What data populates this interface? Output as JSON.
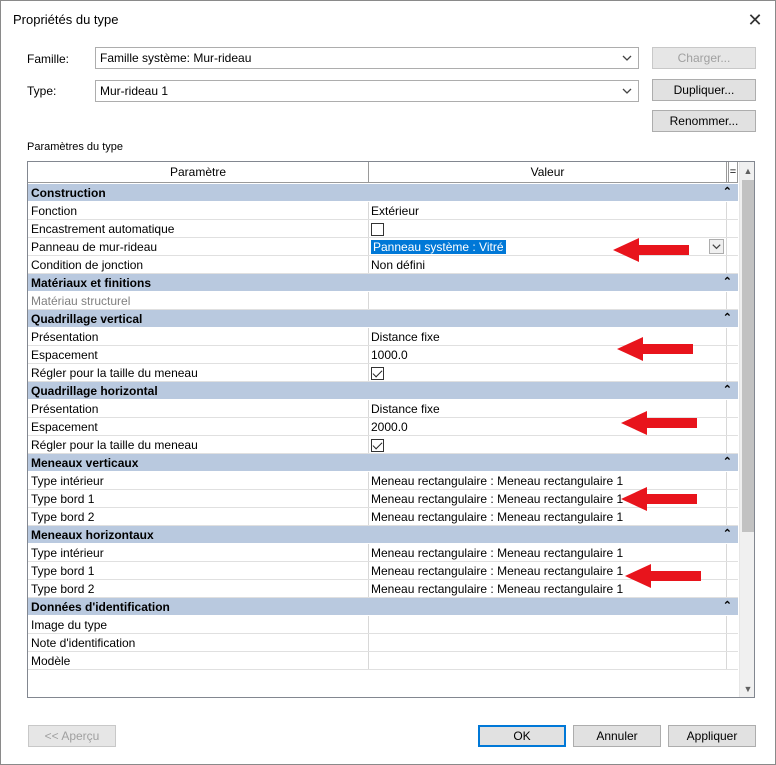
{
  "dialog": {
    "title": "Propriétés du type",
    "close_glyph": "✕"
  },
  "famille": {
    "label": "Famille:",
    "value": "Famille système: Mur-rideau",
    "load_label": "Charger..."
  },
  "type": {
    "label": "Type:",
    "value": "Mur-rideau 1",
    "duplicate_label": "Dupliquer...",
    "rename_label": "Renommer..."
  },
  "params": {
    "section_label": "Paramètres du type",
    "col_param": "Paramètre",
    "col_value": "Valeur",
    "col_eq": "=",
    "collapse_glyph": "⌃",
    "sections": [
      {
        "title": "Construction",
        "rows": [
          {
            "name": "Fonction",
            "value": "Extérieur"
          },
          {
            "name": "Encastrement automatique",
            "value": "",
            "checkbox": false
          },
          {
            "name": "Panneau de mur-rideau",
            "value": "Panneau système : Vitré",
            "selected": true
          },
          {
            "name": "Condition de jonction",
            "value": "Non défini"
          }
        ]
      },
      {
        "title": "Matériaux et finitions",
        "rows": [
          {
            "name": "Matériau structurel",
            "value": "",
            "disabled": true
          }
        ]
      },
      {
        "title": "Quadrillage vertical",
        "rows": [
          {
            "name": "Présentation",
            "value": "Distance fixe"
          },
          {
            "name": "Espacement",
            "value": "1000.0"
          },
          {
            "name": "Régler pour la taille du meneau",
            "value": "",
            "checkbox": true
          }
        ]
      },
      {
        "title": "Quadrillage horizontal",
        "rows": [
          {
            "name": "Présentation",
            "value": "Distance fixe"
          },
          {
            "name": "Espacement",
            "value": "2000.0"
          },
          {
            "name": "Régler pour la taille du meneau",
            "value": "",
            "checkbox": true
          }
        ]
      },
      {
        "title": "Meneaux verticaux",
        "rows": [
          {
            "name": "Type intérieur",
            "value": "Meneau rectangulaire : Meneau rectangulaire 1"
          },
          {
            "name": "Type bord 1",
            "value": "Meneau rectangulaire : Meneau rectangulaire 1"
          },
          {
            "name": "Type bord 2",
            "value": "Meneau rectangulaire : Meneau rectangulaire 1"
          }
        ]
      },
      {
        "title": "Meneaux horizontaux",
        "rows": [
          {
            "name": "Type intérieur",
            "value": "Meneau rectangulaire : Meneau rectangulaire 1"
          },
          {
            "name": "Type bord 1",
            "value": "Meneau rectangulaire : Meneau rectangulaire 1"
          },
          {
            "name": "Type bord 2",
            "value": "Meneau rectangulaire : Meneau rectangulaire 1"
          }
        ]
      },
      {
        "title": "Données d'identification",
        "rows": [
          {
            "name": "Image du type",
            "value": ""
          },
          {
            "name": "Note d'identification",
            "value": ""
          },
          {
            "name": "Modèle",
            "value": ""
          }
        ]
      }
    ]
  },
  "footer": {
    "preview_label": "<< Aperçu",
    "ok_label": "OK",
    "cancel_label": "Annuler",
    "apply_label": "Appliquer"
  },
  "colors": {
    "section_bg": "#b9c9df",
    "selection": "#0078d7",
    "annotation_arrow": "#e8141c"
  },
  "icons": {
    "dropdown": "chevron-down-icon",
    "annotation": "red-arrow-icon"
  }
}
